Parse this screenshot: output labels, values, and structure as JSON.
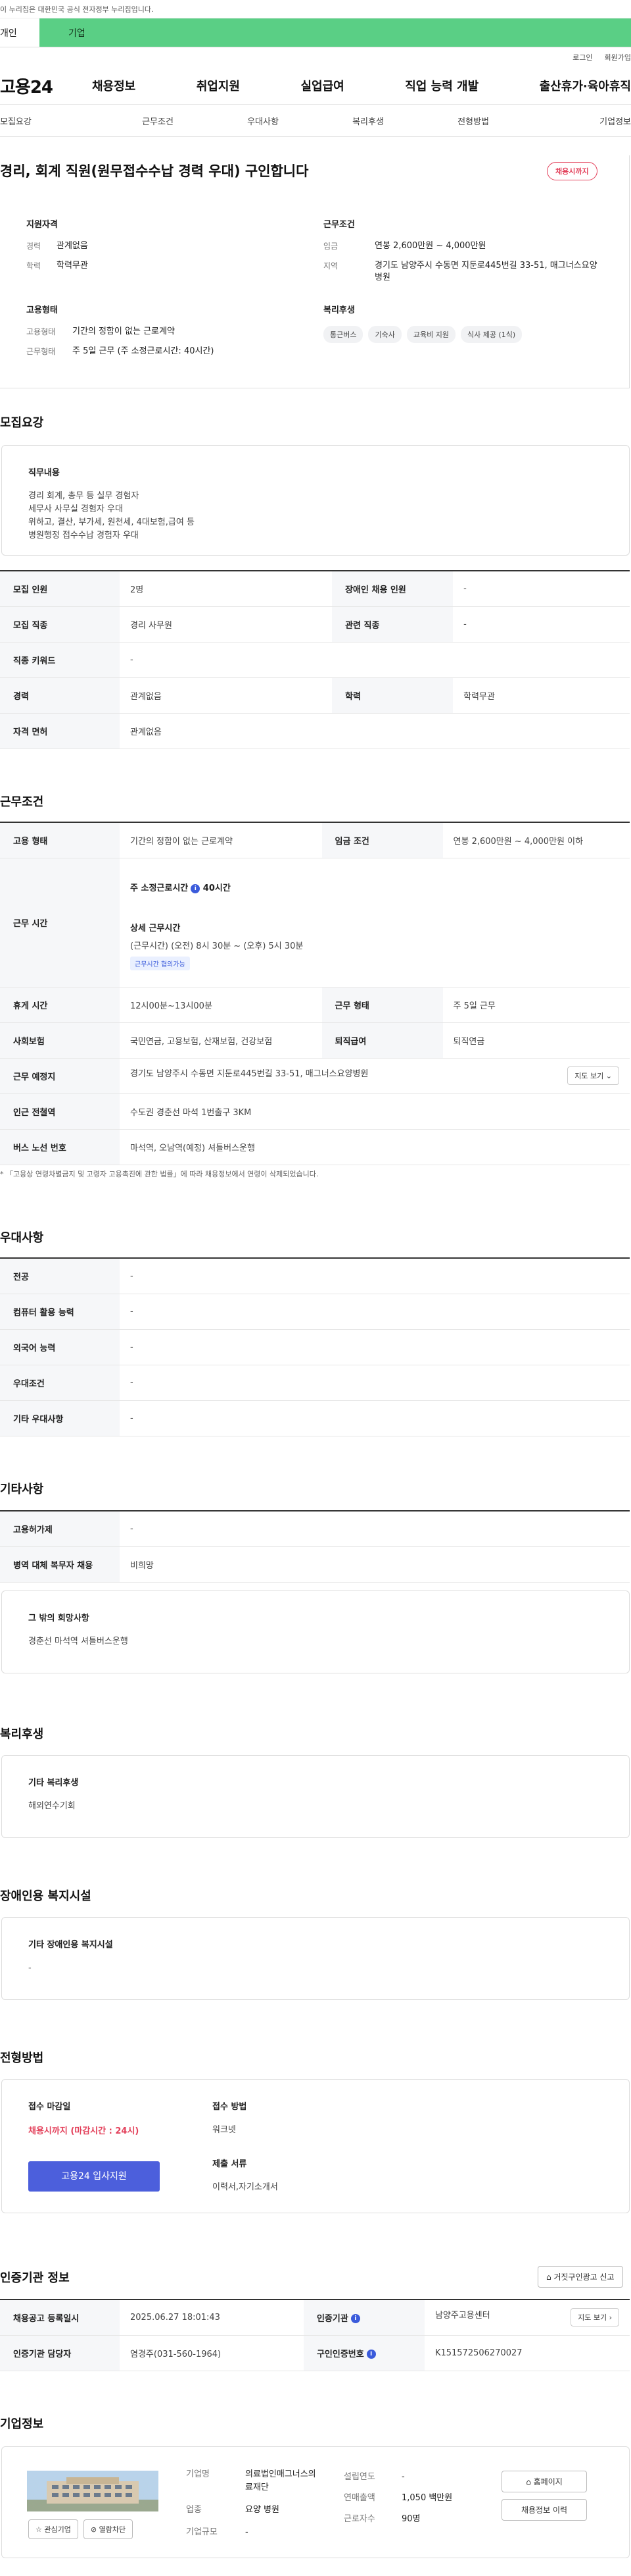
{
  "banner": "이 누리집은 대한민국 공식 전자정부 누리집입니다.",
  "segments": {
    "person": "개인",
    "company": "기업"
  },
  "util": {
    "login": "로그인",
    "join": "회원가입"
  },
  "logo": "고용24",
  "gnb": [
    "채용정보",
    "취업지원",
    "실업급여",
    "직업 능력 개발",
    "출산휴가·육아휴직"
  ],
  "subtabs": [
    "모집요강",
    "근무조건",
    "우대사항",
    "복리후생",
    "전형방법",
    "기업정보"
  ],
  "summary": {
    "title": "경리, 회계 직원(원무접수수납 경력 우대) 구인합니다",
    "deadline_badge": "채용시까지",
    "qual": {
      "heading": "지원자격",
      "career_k": "경력",
      "career_v": "관계없음",
      "edu_k": "학력",
      "edu_v": "학력무관"
    },
    "emp": {
      "heading": "고용형태",
      "type_k": "고용형태",
      "type_v": "기간의 정함이 없는 근로계약",
      "work_k": "근무형태",
      "work_v": "주 5일 근무 (주 소정근로시간: 40시간)"
    },
    "cond": {
      "heading": "근무조건",
      "wage_k": "임금",
      "wage_v": "연봉 2,600만원 ~ 4,000만원",
      "area_k": "지역",
      "area_v": "경기도 남양주시 수동면 지둔로445번길 33-51, 매그너스요양병원"
    },
    "welfare": {
      "heading": "복리후생",
      "chips": [
        "통근버스",
        "기숙사",
        "교육비 지원",
        "식사 제공 (1식)"
      ]
    }
  },
  "recruit": {
    "section_title": "모집요강",
    "duty_title": "직무내용",
    "duty_text": "경리 회계, 총무 등 실무 경험자\n세무사 사무실 경험자 우대\n위하고, 결산, 부가세, 원천세, 4대보험,급여  등\n병원행정 접수수납 경험자 우대",
    "rows": [
      [
        "모집 인원",
        "2명",
        "장애인 채용 인원",
        "-"
      ],
      [
        "모집 직종",
        "경리 사무원",
        "관련 직종",
        "-"
      ],
      [
        "직종 키워드",
        "-"
      ],
      [
        "경력",
        "관계없음",
        "학력",
        "학력무관"
      ],
      [
        "자격 면허",
        "관계없음"
      ]
    ]
  },
  "work": {
    "section_title": "근무조건",
    "emp_k": "고용 형태",
    "emp_v": "기간의 정함이 없는 근로계약",
    "wage_k": "임금 조건",
    "wage_v": "연봉 2,600만원 ~ 4,000만원 이하",
    "time_k": "근무 시간",
    "time_main": "주 소정근로시간",
    "time_hours": "40시간",
    "time_detail_title": "상세 근무시간",
    "time_detail": "(근무시간) (오전) 8시 30분 ~ (오후) 5시 30분",
    "time_badge": "근무시간 협의가능",
    "rest_k": "휴게 시간",
    "rest_v": "12시00분~13시00분",
    "form_k": "근무 형태",
    "form_v": "주 5일 근무",
    "ins_k": "사회보험",
    "ins_v": "국민연금, 고용보험, 산재보험, 건강보험",
    "ret_k": "퇴직급여",
    "ret_v": "퇴직연금",
    "addr_k": "근무 예정지",
    "addr_v": "경기도 남양주시 수동면 지둔로445번길 33-51, 매그너스요양병원",
    "map_btn": "지도 보기",
    "station_k": "인근 전철역",
    "station_v": "수도권 경춘선 마석 1번출구 3KM",
    "bus_k": "버스 노선 번호",
    "bus_v": "마석역, 오남역(예정) 셔틀버스운행",
    "note": "* 「고용상 연령차별금지 및 고령자 고용촉진에 관한 법률」에 따라 채용정보에서 연령이 삭제되었습니다."
  },
  "pref": {
    "section_title": "우대사항",
    "rows": [
      [
        "전공",
        "-"
      ],
      [
        "컴퓨터 활용 능력",
        "-"
      ],
      [
        "외국어 능력",
        "-"
      ],
      [
        "우대조건",
        "-"
      ],
      [
        "기타 우대사항",
        "-"
      ]
    ]
  },
  "etc": {
    "section_title": "기타사항",
    "rows": [
      [
        "고용허가제",
        "-"
      ],
      [
        "병역 대체 복무자 채용",
        "비희망"
      ]
    ],
    "box_title": "그 밖의 희망사항",
    "box_text": "경춘선 마석역 셔틀버스운행"
  },
  "welfare": {
    "section_title": "복리후생",
    "box_title": "기타 복리후생",
    "box_text": "해외연수기회"
  },
  "disab": {
    "section_title": "장애인용 복지시설",
    "box_title": "기타 장애인용 복지시설",
    "box_text": "-"
  },
  "method": {
    "section_title": "전형방법",
    "deadline_k": "접수 마감일",
    "deadline_v": "채용시까지 (마감시간 : 24시)",
    "apply_btn": "고용24 입사지원",
    "way_k": "접수 방법",
    "way_v": "워크넷",
    "docs_k": "제출 서류",
    "docs_v": "이력서,자기소개서"
  },
  "cert": {
    "section_title": "인증기관 정보",
    "report_btn": "거짓구인광고 신고",
    "reg_k": "채용공고 등록일시",
    "reg_v": "2025.06.27 18:01:43",
    "org_k": "인증기관",
    "org_v": "남양주고용센터",
    "map_btn": "지도 보기",
    "mgr_k": "인증기관 담당자",
    "mgr_v": "염경주(031-560-1964)",
    "no_k": "구인인증번호",
    "no_v": "K151572506270027"
  },
  "company": {
    "section_title": "기업정보",
    "fav_btn": "관심기업",
    "block_btn": "열람차단",
    "name_k": "기업명",
    "name_v": "의료법인매그너스의료재단",
    "year_k": "설립연도",
    "year_v": "-",
    "sales_k": "연매출액",
    "sales_v": "1,050 백만원",
    "ind_k": "업종",
    "ind_v": "요양 병원",
    "emp_k": "근로자수",
    "emp_v": "90명",
    "size_k": "기업규모",
    "size_v": "-",
    "home_btn": "홈페이지",
    "history_btn": "채용정보 이력"
  }
}
